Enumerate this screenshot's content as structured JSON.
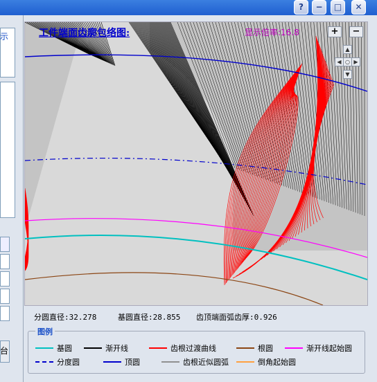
{
  "window": {
    "buttons": [
      {
        "name": "help-button",
        "glyph": "?"
      },
      {
        "name": "minimize-button",
        "glyph": "−"
      },
      {
        "name": "maximize-button",
        "glyph": "□"
      },
      {
        "name": "close-button",
        "glyph": "✕"
      }
    ]
  },
  "left_panel": {
    "partial_label_top": "示",
    "partial_label_bottom": "台"
  },
  "canvas": {
    "title": "工件端面齿廓包络图:",
    "zoom_label": "显示倍率:",
    "zoom_value": "16.8",
    "zoom_in": "+",
    "zoom_out": "−",
    "nav": {
      "up": "▲",
      "down": "▼",
      "left": "◀",
      "right": "▶",
      "center": "○"
    }
  },
  "info": {
    "pitch_dia_label": "分圆直径:",
    "pitch_dia_value": "32.278",
    "base_dia_label": "基圆直径:",
    "base_dia_value": "28.855",
    "tip_thickness_label": "齿顶端面弧齿厚:",
    "tip_thickness_value": "0.926"
  },
  "legend": {
    "title": "图例",
    "items": [
      {
        "label": "基圆",
        "color": "#00c0c0",
        "style": "solid"
      },
      {
        "label": "渐开线",
        "color": "#000000",
        "style": "solid"
      },
      {
        "label": "齿根过渡曲线",
        "color": "#ff0000",
        "style": "solid"
      },
      {
        "label": "根圆",
        "color": "#8b4513",
        "style": "solid"
      },
      {
        "label": "渐开线起始圆",
        "color": "#ff00ff",
        "style": "solid"
      },
      {
        "label": "分度圆",
        "color": "#0000cc",
        "style": "dashed"
      },
      {
        "label": "顶圆",
        "color": "#0000cc",
        "style": "solid"
      },
      {
        "label": "齿根近似圆弧",
        "color": "#909090",
        "style": "solid"
      },
      {
        "label": "倒角起始圆",
        "color": "#ffa040",
        "style": "solid"
      }
    ]
  },
  "colors": {
    "canvas_bg": "#d9d9d9",
    "involute": "#000000",
    "fillet": "#ff0000",
    "base_circle": "#00c0c0",
    "tip_circle": "#0000cc",
    "root_circle": "#8b4513",
    "start_circle": "#ff00ff"
  }
}
